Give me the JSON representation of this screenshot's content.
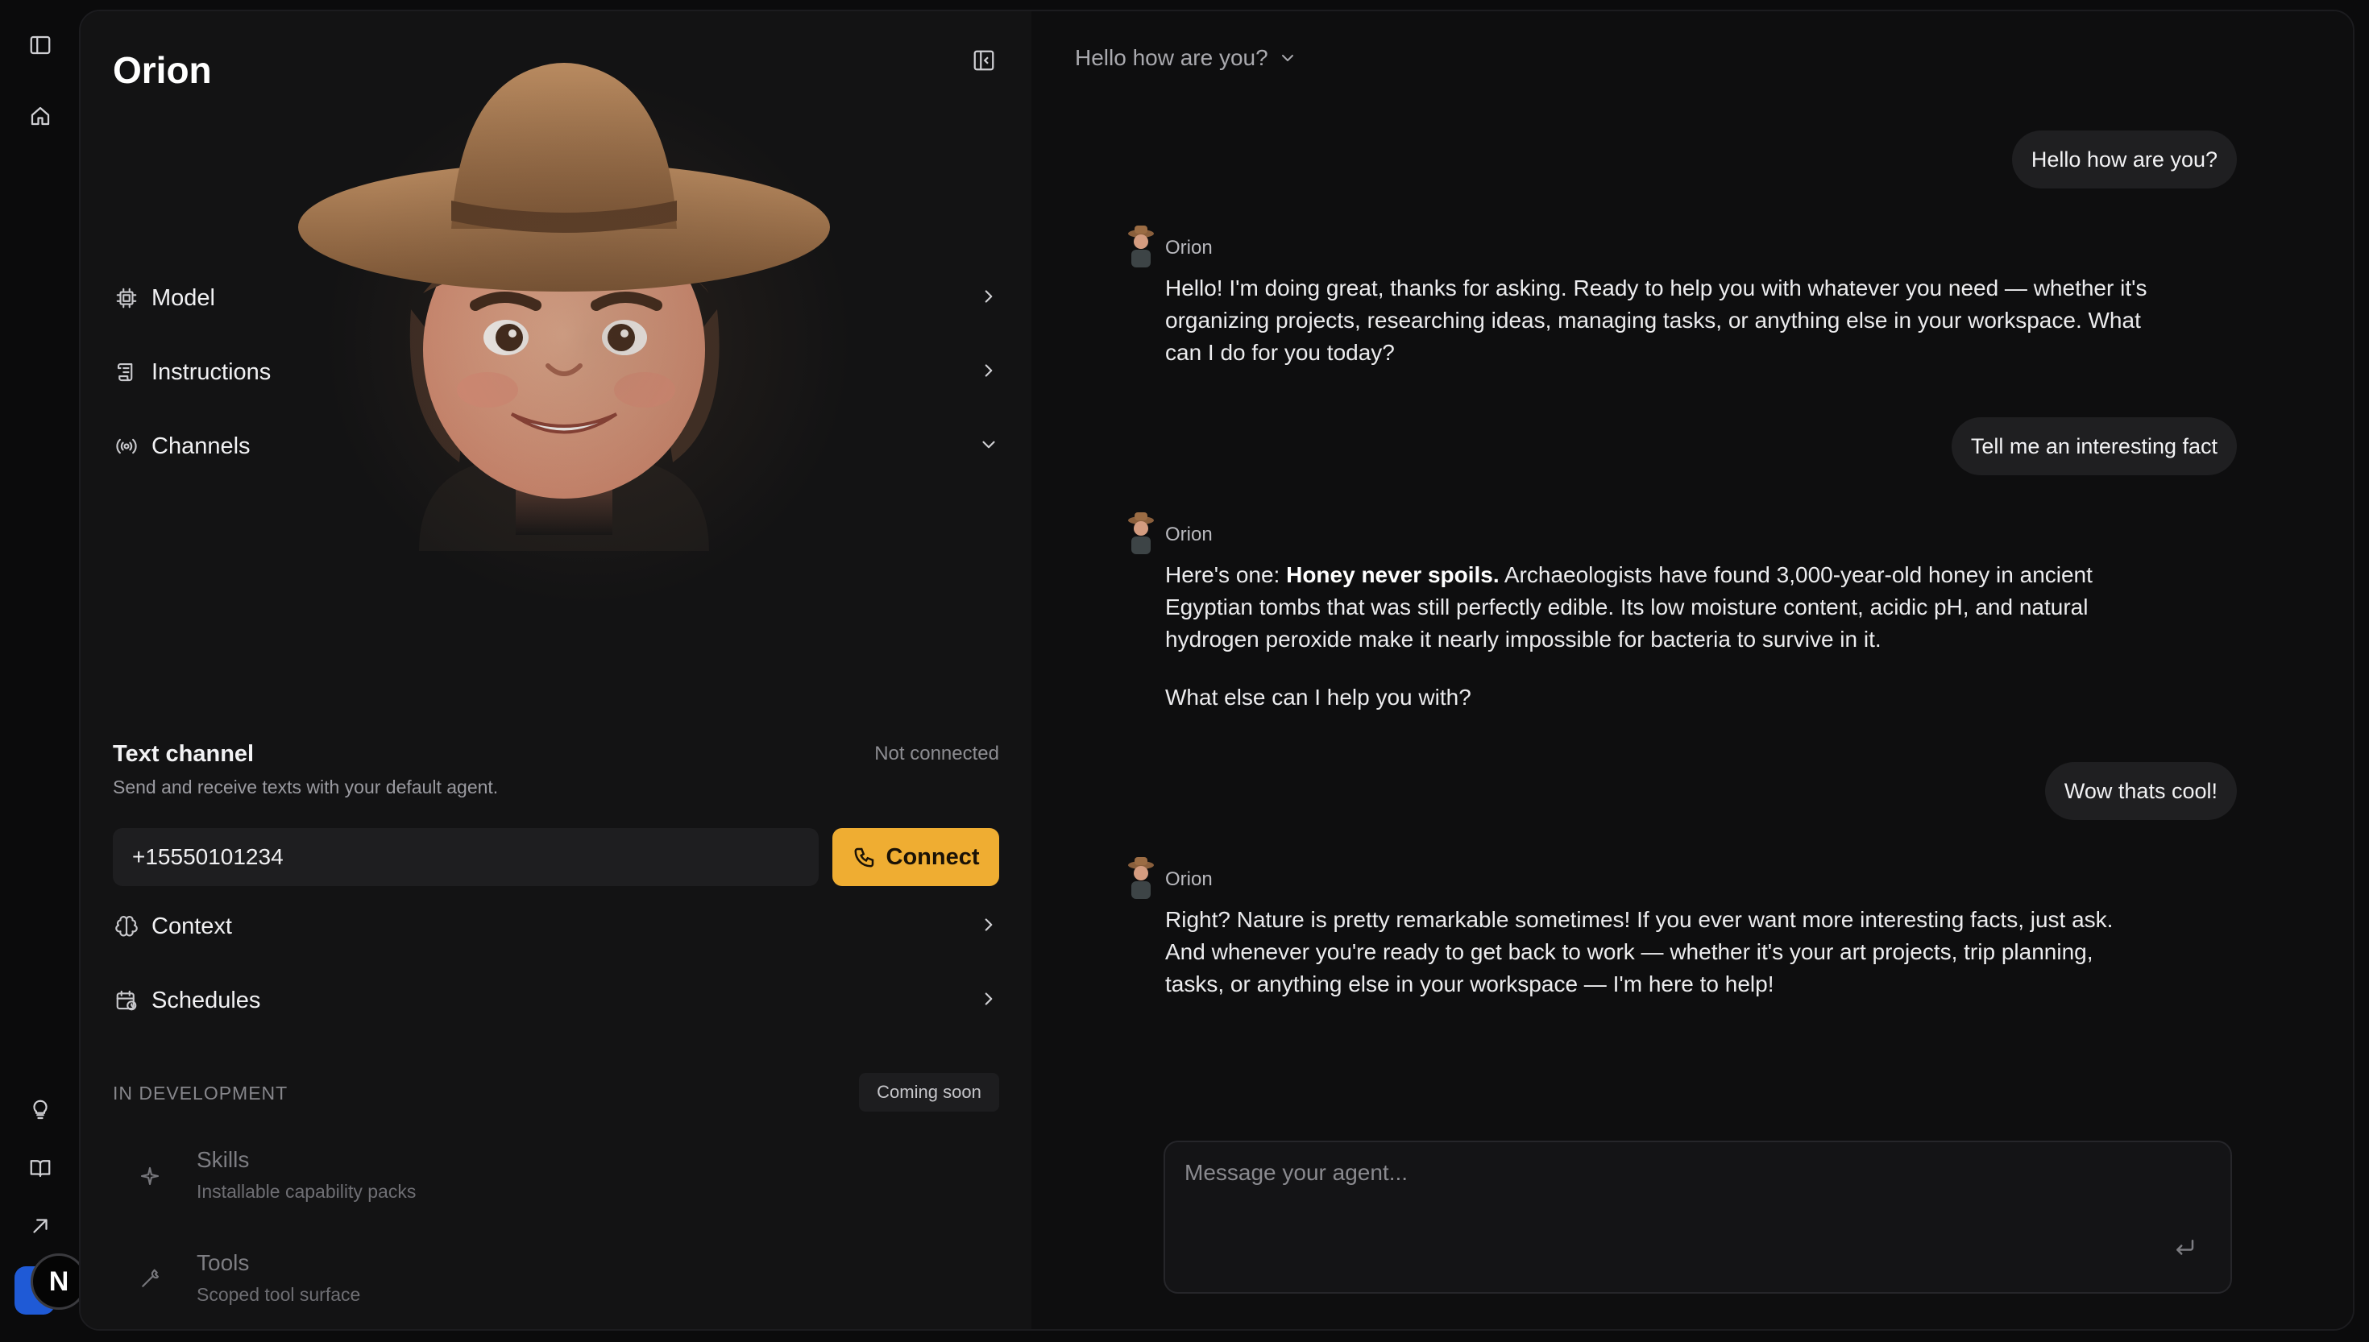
{
  "agent": {
    "name": "Orion"
  },
  "sections": {
    "model": "Model",
    "instructions": "Instructions",
    "channels": "Channels",
    "context": "Context",
    "schedules": "Schedules"
  },
  "text_channel": {
    "title": "Text channel",
    "status": "Not connected",
    "description": "Send and receive texts with your default agent.",
    "phone_value": "+15550101234",
    "connect_label": "Connect"
  },
  "in_development": {
    "heading": "IN DEVELOPMENT",
    "badge": "Coming soon",
    "items": [
      {
        "title": "Skills",
        "subtitle": "Installable capability packs",
        "icon": "sparkle-icon"
      },
      {
        "title": "Tools",
        "subtitle": "Scoped tool surface",
        "icon": "wrench-icon"
      }
    ]
  },
  "rail": {
    "badge_letter": "N"
  },
  "chat": {
    "title": "Hello how are you?",
    "messages": [
      {
        "role": "user",
        "text": "Hello how are you?"
      },
      {
        "role": "agent",
        "name": "Orion",
        "text": "Hello! I'm doing great, thanks for asking. Ready to help you with whatever you need — whether it's organizing projects, researching ideas, managing tasks, or anything else in your workspace. What can I do for you today?"
      },
      {
        "role": "user",
        "text": "Tell me an interesting fact"
      },
      {
        "role": "agent",
        "name": "Orion",
        "bold": "Honey never spoils.",
        "prefix": "Here's one: ",
        "text": " Archaeologists have found 3,000-year-old honey in ancient Egyptian tombs that was still perfectly edible. Its low moisture content, acidic pH, and natural hydrogen peroxide make it nearly impossible for bacteria to survive in it.",
        "followup": "What else can I help you with?"
      },
      {
        "role": "user",
        "text": "Wow thats cool!"
      },
      {
        "role": "agent",
        "name": "Orion",
        "text": "Right? Nature is pretty remarkable sometimes! If you ever want more interesting facts, just ask. And whenever you're ready to get back to work — whether it's your art projects, trip planning, tasks, or anything else in your workspace — I'm here to help!"
      }
    ],
    "composer_placeholder": "Message your agent..."
  },
  "colors": {
    "accent": "#efad32",
    "panel": "#131314",
    "chat_bg": "#0e0e0f",
    "bubble": "#1f1f21"
  }
}
